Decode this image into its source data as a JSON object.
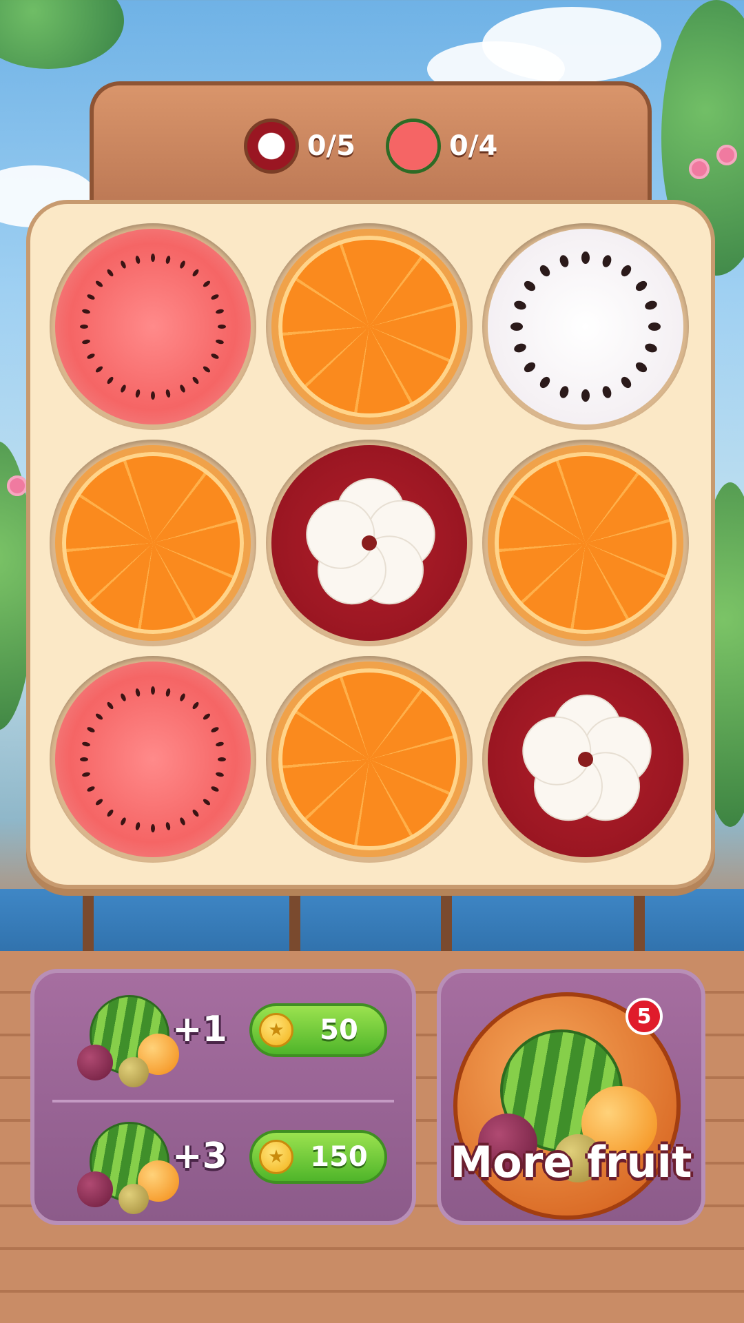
{
  "goals": [
    {
      "fruit": "mangosteen",
      "icon": "mangosteen-icon",
      "progress": "0/5"
    },
    {
      "fruit": "watermelon",
      "icon": "watermelon-icon",
      "progress": "0/4"
    }
  ],
  "board": {
    "rows": 3,
    "cols": 3,
    "cells": [
      "watermelon",
      "orange",
      "dragonfruit",
      "orange",
      "mangosteen",
      "orange",
      "watermelon",
      "orange",
      "mangosteen"
    ]
  },
  "shop": {
    "offers": [
      {
        "amount": "+1",
        "price": "50",
        "currency_icon": "coin-icon"
      },
      {
        "amount": "+3",
        "price": "150",
        "currency_icon": "coin-icon"
      }
    ]
  },
  "more_fruit": {
    "label": "More fruit",
    "badge_count": "5"
  },
  "colors": {
    "goal_panel": "#c98460",
    "board_bg": "#fbe8c6",
    "shop_panel": "#9a6596",
    "price_button": "#6cc93a",
    "badge": "#e01b2b"
  }
}
